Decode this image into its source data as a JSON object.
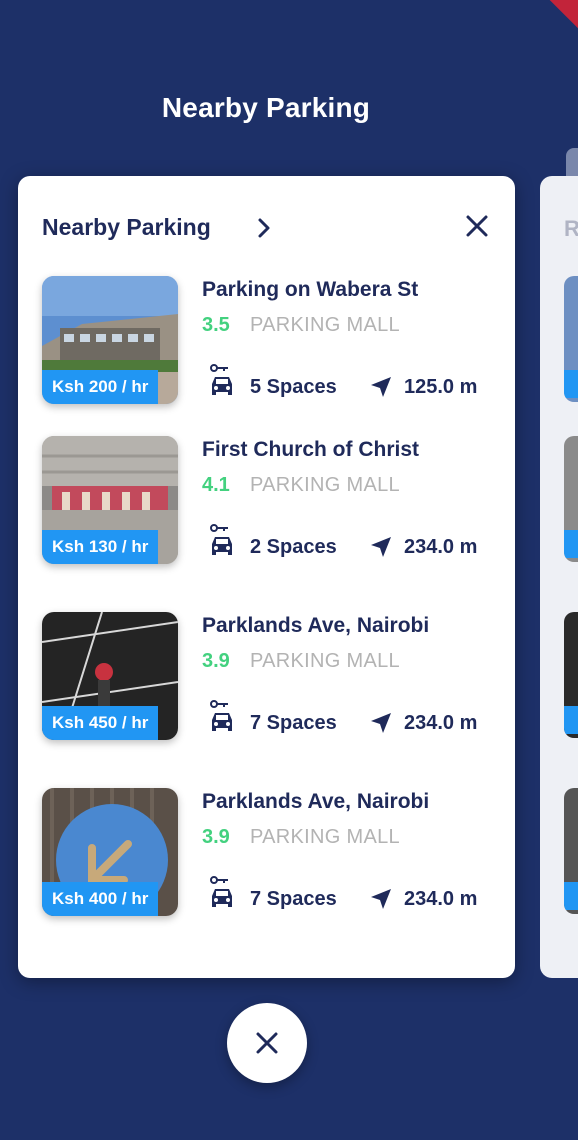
{
  "header": {
    "title": "Nearby Parking"
  },
  "card": {
    "title": "Nearby Parking",
    "chevron_icon": "chevron-right-icon",
    "close_icon": "close-icon"
  },
  "next_card_peek": {
    "letter": "R"
  },
  "items": [
    {
      "name": "Parking on Wabera St",
      "rating": "3.5",
      "category": "PARKING MALL",
      "price": "Ksh 200 / hr",
      "spaces": "5 Spaces",
      "distance": "125.0 m"
    },
    {
      "name": "First Church of Christ",
      "rating": "4.1",
      "category": "PARKING MALL",
      "price": "Ksh 130 / hr",
      "spaces": "2 Spaces",
      "distance": "234.0 m"
    },
    {
      "name": "Parklands Ave, Nairobi",
      "rating": "3.9",
      "category": "PARKING MALL",
      "price": "Ksh 450 / hr",
      "spaces": "7 Spaces",
      "distance": "234.0 m"
    },
    {
      "name": "Parklands Ave, Nairobi",
      "rating": "3.9",
      "category": "PARKING MALL",
      "price": "Ksh 400 / hr",
      "spaces": "7 Spaces",
      "distance": "234.0 m"
    }
  ],
  "colors": {
    "background": "#1d3068",
    "price_badge": "#2196f3",
    "rating": "#43d17f",
    "text_dark": "#1f2a5a",
    "category": "#b3b3b3"
  }
}
